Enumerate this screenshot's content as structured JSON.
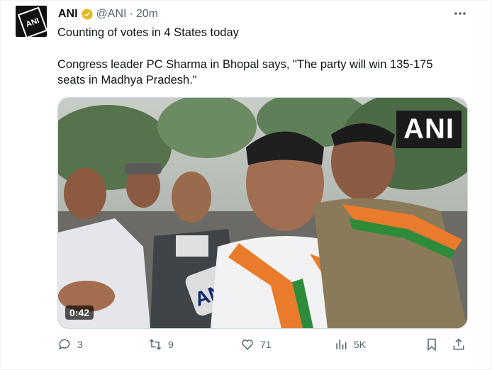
{
  "tweet": {
    "author": {
      "name": "ANI",
      "handle": "@ANI",
      "separator": "·",
      "time": "20m",
      "avatar_text": "ANI"
    },
    "text_lines": [
      "Counting of votes in 4 States today",
      "Congress leader PC Sharma in Bhopal says, \"The party will win 135-175",
      "seats in Madhya Pradesh.\""
    ],
    "media": {
      "watermark": "ANI",
      "duration": "0:42",
      "mic_text": "ANI"
    },
    "actions": {
      "reply_count": "3",
      "retweet_count": "9",
      "like_count": "71",
      "views_count": "5K"
    }
  },
  "colors": {
    "text": "#0f1419",
    "muted": "#536471",
    "verified": "#e2b719",
    "border": "#cfd9de"
  }
}
